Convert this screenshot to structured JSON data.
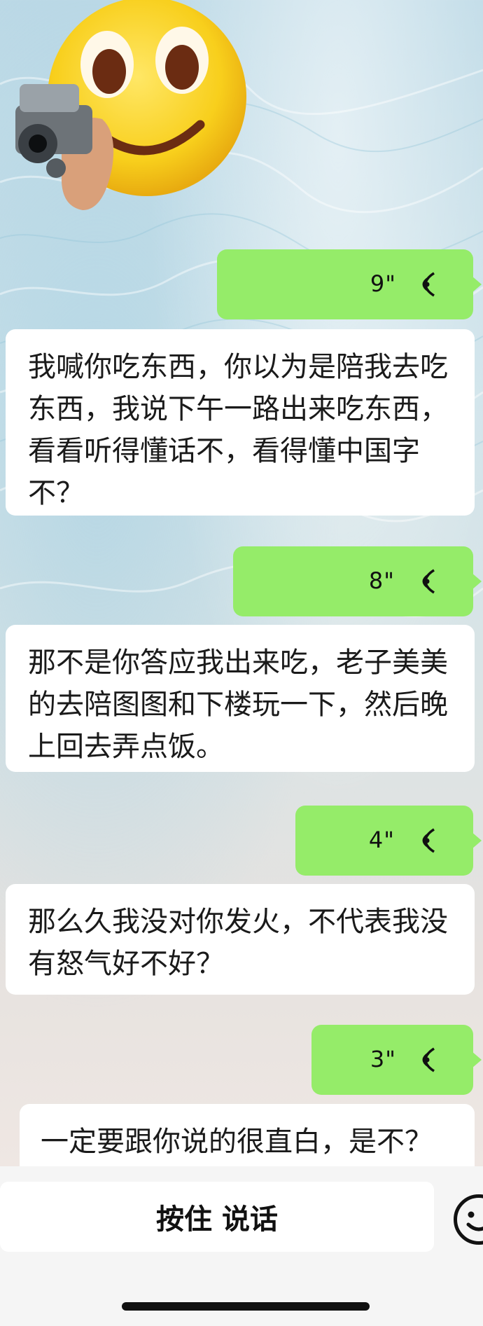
{
  "messages": [
    {
      "type": "voice",
      "side": "right",
      "duration": "9\""
    },
    {
      "type": "text",
      "side": "left",
      "text": "我喊你吃东西，你以为是陪我去吃东西，我说下午一路出来吃东西，看看听得懂话不，看得懂中国字不？"
    },
    {
      "type": "voice",
      "side": "right",
      "duration": "8\""
    },
    {
      "type": "text",
      "side": "left",
      "text": "那不是你答应我出来吃，老子美美的去陪图图和下楼玩一下，然后晚上回去弄点饭。"
    },
    {
      "type": "voice",
      "side": "right",
      "duration": "4\""
    },
    {
      "type": "text",
      "side": "left",
      "text": "那么久我没对你发火，不代表我没有怒气好不好？"
    },
    {
      "type": "voice",
      "side": "right",
      "duration": "3\""
    },
    {
      "type": "text",
      "side": "left",
      "text": "一定要跟你说的很直白，是不？"
    }
  ],
  "input_bar": {
    "hold_to_talk_label": "按住 说话",
    "emoji_icon": "emoji-face-icon"
  },
  "colors": {
    "voice_bubble": "#95ec69",
    "text_bubble": "#ffffff",
    "bottom_bar": "#f5f5f5"
  }
}
